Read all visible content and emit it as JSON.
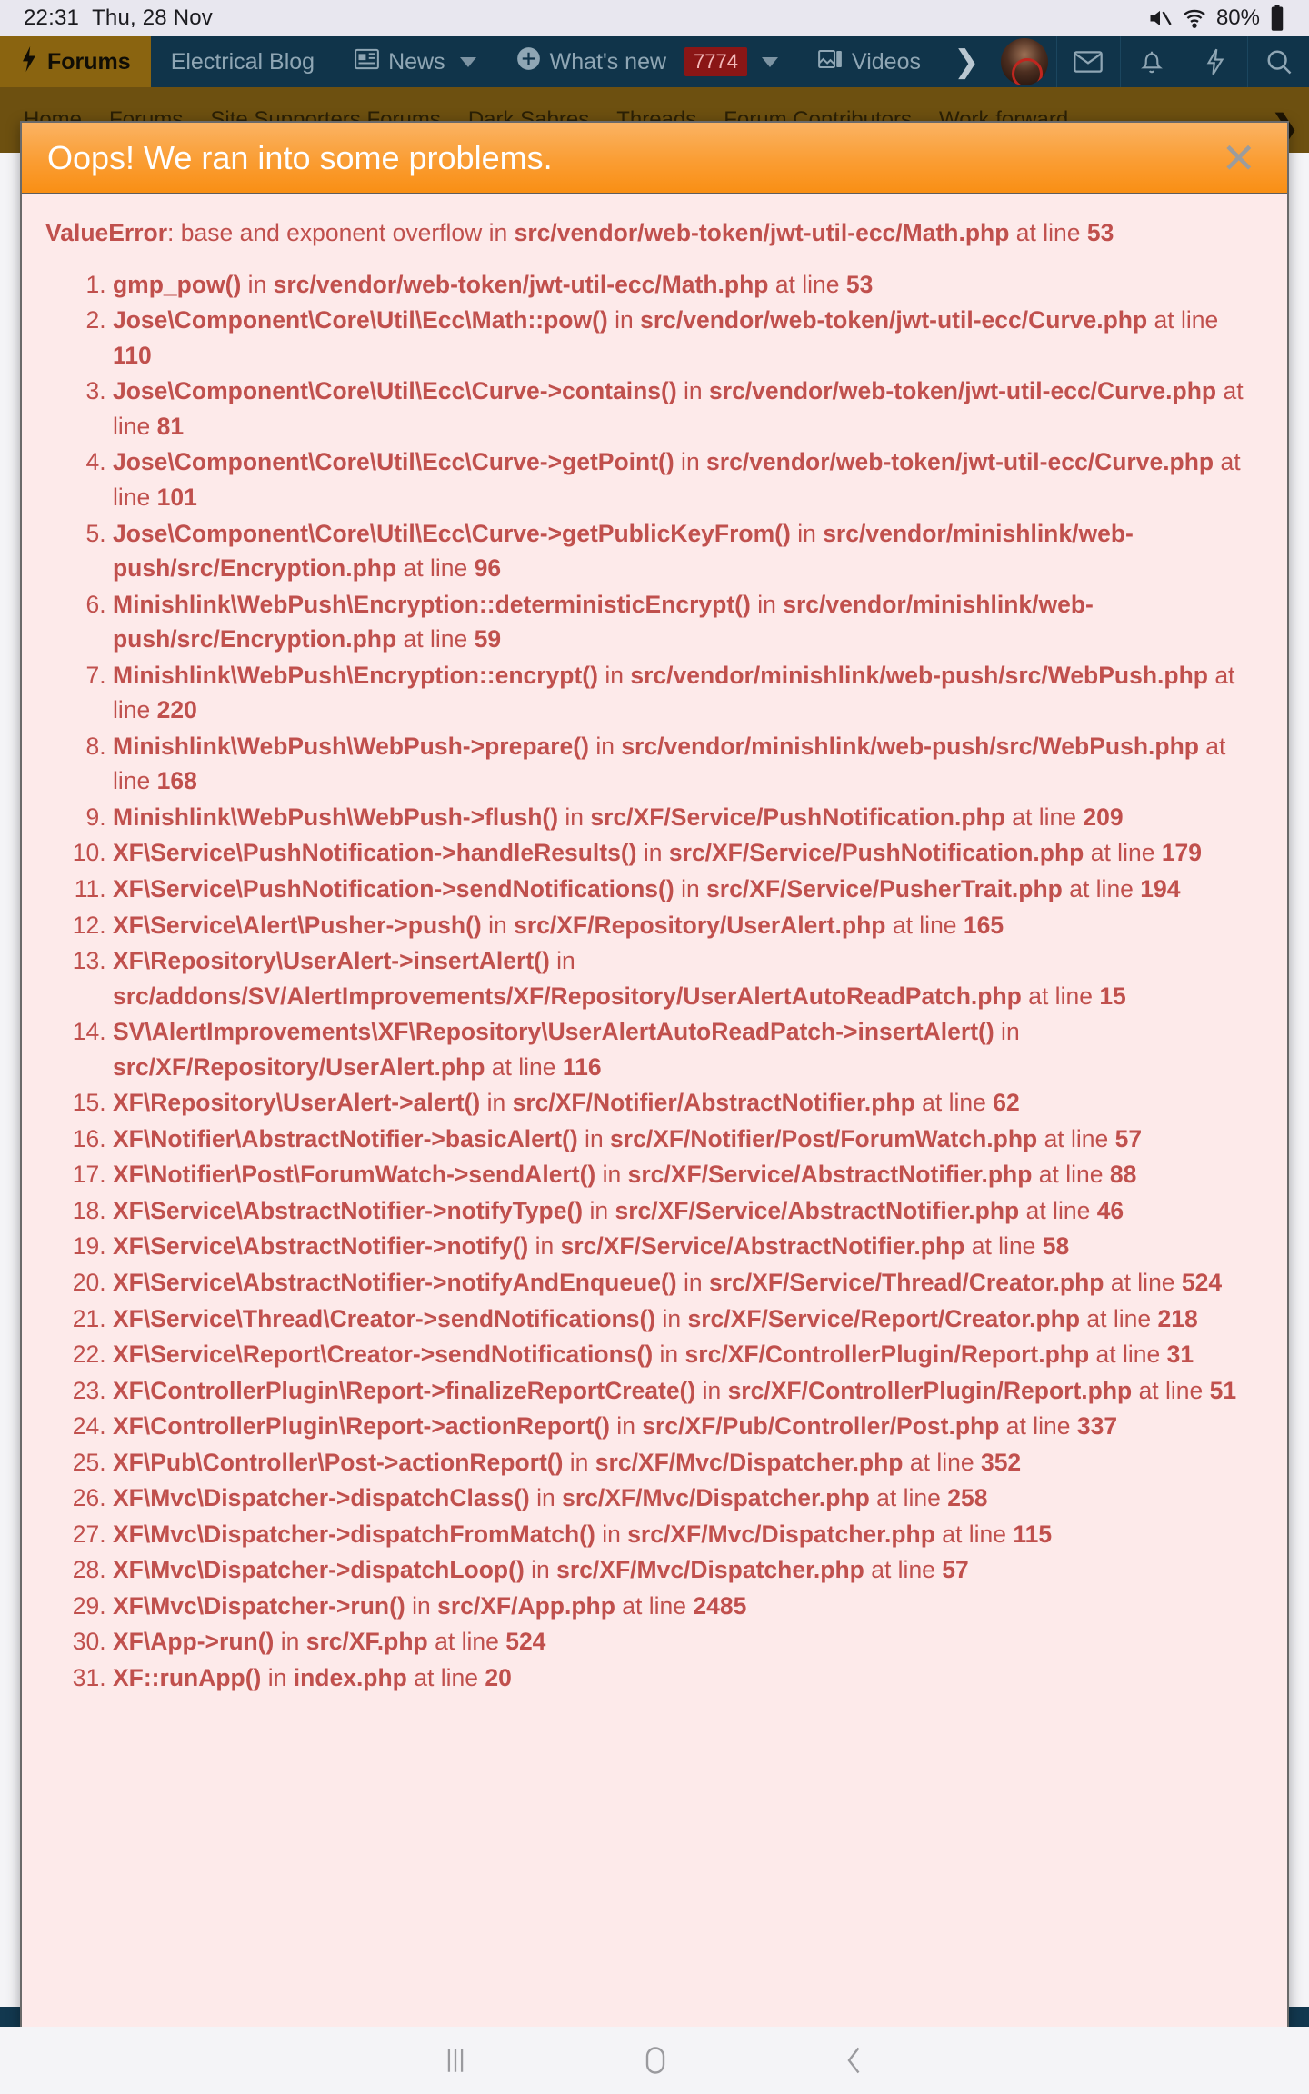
{
  "status_bar": {
    "time": "22:31",
    "date": "Thu, 28 Nov",
    "battery": "80%",
    "icons": [
      "mute-icon",
      "wifi-icon",
      "battery-icon"
    ]
  },
  "navbar": {
    "items": [
      {
        "label": "Forums",
        "icon": "bolt-icon",
        "active": true,
        "caret": false,
        "badge": null
      },
      {
        "label": "Electrical Blog",
        "icon": null,
        "active": false,
        "caret": false,
        "badge": null
      },
      {
        "label": "News",
        "icon": "newspaper-icon",
        "active": false,
        "caret": true,
        "badge": null
      },
      {
        "label": "What's new",
        "icon": "plus-circle-icon",
        "active": false,
        "caret": true,
        "badge": "7774"
      },
      {
        "label": "Videos",
        "icon": "media-icon",
        "active": false,
        "caret": false,
        "badge": null
      }
    ],
    "overflow_icon": "chevron-right-icon",
    "right_icons": [
      "avatar",
      "envelope-icon",
      "bell-icon",
      "bolt-icon",
      "search-icon"
    ]
  },
  "breadcrumb": {
    "items": [
      "Home",
      "Forums",
      "Site Supporters Forums",
      "Dark Sabres",
      "Threads",
      "Forum Contributors",
      "Work forward"
    ],
    "expand_icon": "chevron-right-icon"
  },
  "error_overlay": {
    "title": "Oops! We ran into some problems.",
    "close_label": "✕",
    "summary": {
      "type": "ValueError",
      "separator": ": ",
      "message": "base and exponent overflow",
      "in_word": " in ",
      "file": "src/vendor/web-token/jwt-util-ecc/Math.php",
      "at_word": " at line ",
      "line": "53"
    },
    "trace": [
      {
        "n": 1,
        "call": "gmp_pow()",
        "file": "src/vendor/web-token/jwt-util-ecc/Math.php",
        "line": "53"
      },
      {
        "n": 2,
        "call": "Jose\\Component\\Core\\Util\\Ecc\\Math::pow()",
        "file": "src/vendor/web-token/jwt-util-ecc/Curve.php",
        "line": "110"
      },
      {
        "n": 3,
        "call": "Jose\\Component\\Core\\Util\\Ecc\\Curve->contains()",
        "file": "src/vendor/web-token/jwt-util-ecc/Curve.php",
        "line": "81"
      },
      {
        "n": 4,
        "call": "Jose\\Component\\Core\\Util\\Ecc\\Curve->getPoint()",
        "file": "src/vendor/web-token/jwt-util-ecc/Curve.php",
        "line": "101"
      },
      {
        "n": 5,
        "call": "Jose\\Component\\Core\\Util\\Ecc\\Curve->getPublicKeyFrom()",
        "file": "src/vendor/minishlink/web-push/src/Encryption.php",
        "line": "96"
      },
      {
        "n": 6,
        "call": "Minishlink\\WebPush\\Encryption::deterministicEncrypt()",
        "file": "src/vendor/minishlink/web-push/src/Encryption.php",
        "line": "59"
      },
      {
        "n": 7,
        "call": "Minishlink\\WebPush\\Encryption::encrypt()",
        "file": "src/vendor/minishlink/web-push/src/WebPush.php",
        "line": "220"
      },
      {
        "n": 8,
        "call": "Minishlink\\WebPush\\WebPush->prepare()",
        "file": "src/vendor/minishlink/web-push/src/WebPush.php",
        "line": "168"
      },
      {
        "n": 9,
        "call": "Minishlink\\WebPush\\WebPush->flush()",
        "file": "src/XF/Service/PushNotification.php",
        "line": "209"
      },
      {
        "n": 10,
        "call": "XF\\Service\\PushNotification->handleResults()",
        "file": "src/XF/Service/PushNotification.php",
        "line": "179"
      },
      {
        "n": 11,
        "call": "XF\\Service\\PushNotification->sendNotifications()",
        "file": "src/XF/Service/PusherTrait.php",
        "line": "194"
      },
      {
        "n": 12,
        "call": "XF\\Service\\Alert\\Pusher->push()",
        "file": "src/XF/Repository/UserAlert.php",
        "line": "165"
      },
      {
        "n": 13,
        "call": "XF\\Repository\\UserAlert->insertAlert()",
        "file": "src/addons/SV/AlertImprovements/XF/Repository/UserAlertAutoReadPatch.php",
        "line": "15"
      },
      {
        "n": 14,
        "call": "SV\\AlertImprovements\\XF\\Repository\\UserAlertAutoReadPatch->insertAlert()",
        "file": "src/XF/Repository/UserAlert.php",
        "line": "116"
      },
      {
        "n": 15,
        "call": "XF\\Repository\\UserAlert->alert()",
        "file": "src/XF/Notifier/AbstractNotifier.php",
        "line": "62"
      },
      {
        "n": 16,
        "call": "XF\\Notifier\\AbstractNotifier->basicAlert()",
        "file": "src/XF/Notifier/Post/ForumWatch.php",
        "line": "57"
      },
      {
        "n": 17,
        "call": "XF\\Notifier\\Post\\ForumWatch->sendAlert()",
        "file": "src/XF/Service/AbstractNotifier.php",
        "line": "88"
      },
      {
        "n": 18,
        "call": "XF\\Service\\AbstractNotifier->notifyType()",
        "file": "src/XF/Service/AbstractNotifier.php",
        "line": "46"
      },
      {
        "n": 19,
        "call": "XF\\Service\\AbstractNotifier->notify()",
        "file": "src/XF/Service/AbstractNotifier.php",
        "line": "58"
      },
      {
        "n": 20,
        "call": "XF\\Service\\AbstractNotifier->notifyAndEnqueue()",
        "file": "src/XF/Service/Thread/Creator.php",
        "line": "524"
      },
      {
        "n": 21,
        "call": "XF\\Service\\Thread\\Creator->sendNotifications()",
        "file": "src/XF/Service/Report/Creator.php",
        "line": "218"
      },
      {
        "n": 22,
        "call": "XF\\Service\\Report\\Creator->sendNotifications()",
        "file": "src/XF/ControllerPlugin/Report.php",
        "line": "31"
      },
      {
        "n": 23,
        "call": "XF\\ControllerPlugin\\Report->finalizeReportCreate()",
        "file": "src/XF/ControllerPlugin/Report.php",
        "line": "51"
      },
      {
        "n": 24,
        "call": "XF\\ControllerPlugin\\Report->actionReport()",
        "file": "src/XF/Pub/Controller/Post.php",
        "line": "337"
      },
      {
        "n": 25,
        "call": "XF\\Pub\\Controller\\Post->actionReport()",
        "file": "src/XF/Mvc/Dispatcher.php",
        "line": "352"
      },
      {
        "n": 26,
        "call": "XF\\Mvc\\Dispatcher->dispatchClass()",
        "file": "src/XF/Mvc/Dispatcher.php",
        "line": "258"
      },
      {
        "n": 27,
        "call": "XF\\Mvc\\Dispatcher->dispatchFromMatch()",
        "file": "src/XF/Mvc/Dispatcher.php",
        "line": "115"
      },
      {
        "n": 28,
        "call": "XF\\Mvc\\Dispatcher->dispatchLoop()",
        "file": "src/XF/Mvc/Dispatcher.php",
        "line": "57"
      },
      {
        "n": 29,
        "call": "XF\\Mvc\\Dispatcher->run()",
        "file": "src/XF/App.php",
        "line": "2485"
      },
      {
        "n": 30,
        "call": "XF\\App->run()",
        "file": "src/XF.php",
        "line": "524"
      },
      {
        "n": 31,
        "call": "XF::runApp()",
        "file": "index.php",
        "line": "20"
      }
    ],
    "in_word": " in ",
    "at_word": " at line "
  },
  "system_nav": {
    "recents_label": "|||",
    "home_label": "home-icon",
    "back_label": "back-icon"
  },
  "colors": {
    "accent_orange": "#f98f14",
    "error_red": "#c0504d",
    "error_bg": "#fdeaea",
    "nav_blue": "#10344a",
    "nav_active_gold": "#8a6410",
    "badge_red": "#8a1616"
  }
}
